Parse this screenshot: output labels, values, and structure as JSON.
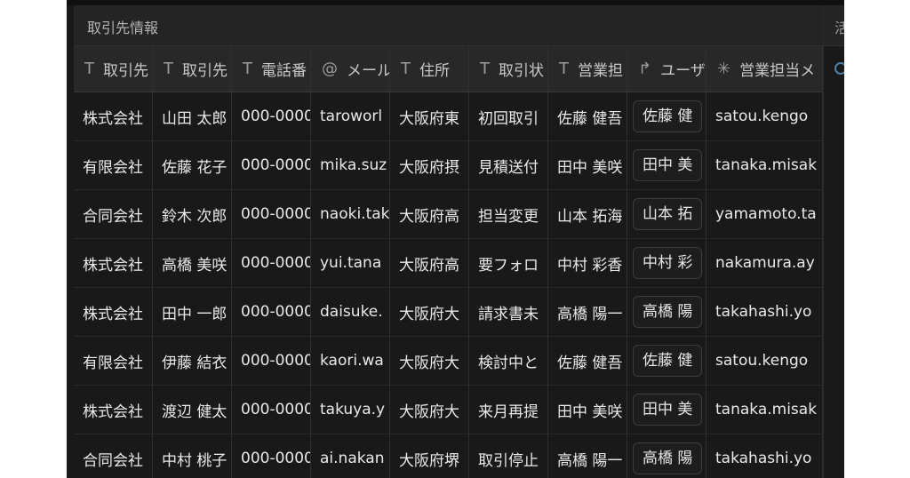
{
  "app": {
    "title": "取引先情報",
    "side_char": "活"
  },
  "table": {
    "headers": [
      {
        "icon": "text-icon",
        "glyph": "T",
        "label": "取引先"
      },
      {
        "icon": "text-icon",
        "glyph": "T",
        "label": "取引先"
      },
      {
        "icon": "text-icon",
        "glyph": "T",
        "label": "電話番"
      },
      {
        "icon": "at-icon",
        "glyph": "@",
        "label": "メール"
      },
      {
        "icon": "text-icon",
        "glyph": "T",
        "label": "住所"
      },
      {
        "icon": "text-icon",
        "glyph": "T",
        "label": "取引状"
      },
      {
        "icon": "text-icon",
        "glyph": "T",
        "label": "営業担"
      },
      {
        "icon": "relation-arrow-icon",
        "glyph": "↱",
        "label": "ユーザ"
      },
      {
        "icon": "asterisk-icon",
        "glyph": "✳",
        "label": "営業担当メ"
      }
    ],
    "rows": [
      [
        "株式会社",
        "山田 太郎",
        "000-0000",
        "taroworl",
        "大阪府東",
        "初回取引",
        "佐藤 健吾",
        "佐藤 健",
        "satou.kengo"
      ],
      [
        "有限会社",
        "佐藤 花子",
        "000-0000",
        "mika.suz",
        "大阪府摂",
        "見積送付",
        "田中 美咲",
        "田中 美",
        "tanaka.misak"
      ],
      [
        "合同会社",
        "鈴木 次郎",
        "000-0000",
        "naoki.tak",
        "大阪府高",
        "担当変更",
        "山本 拓海",
        "山本 拓",
        "yamamoto.ta"
      ],
      [
        "株式会社",
        "高橋 美咲",
        "000-0000",
        "yui.tana",
        "大阪府高",
        "要フォロ",
        "中村 彩香",
        "中村 彩",
        "nakamura.ay"
      ],
      [
        "株式会社",
        "田中 一郎",
        "000-0000",
        "daisuke.",
        "大阪府大",
        "請求書未",
        "高橋 陽一",
        "高橋 陽",
        "takahashi.yo"
      ],
      [
        "有限会社",
        "伊藤 結衣",
        "000-0000",
        "kaori.wa",
        "大阪府大",
        "検討中と",
        "佐藤 健吾",
        "佐藤 健",
        "satou.kengo"
      ],
      [
        "株式会社",
        "渡辺 健太",
        "000-0000",
        "takuya.y",
        "大阪府大",
        "来月再提",
        "田中 美咲",
        "田中 美",
        "tanaka.misak"
      ],
      [
        "合同会社",
        "中村 桃子",
        "000-0000",
        "ai.nakan",
        "大阪府堺",
        "取引停止",
        "高橋 陽一",
        "高橋 陽",
        "takahashi.yo"
      ]
    ]
  }
}
